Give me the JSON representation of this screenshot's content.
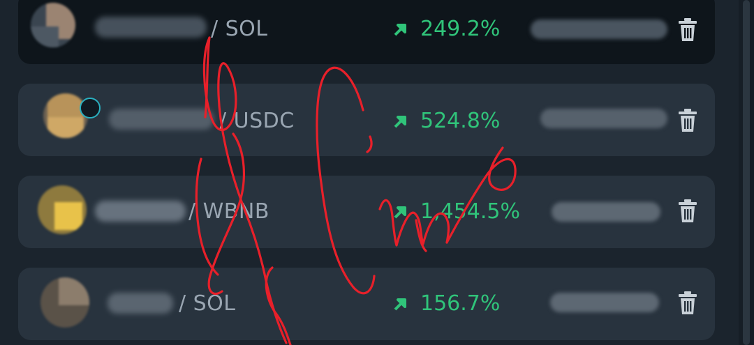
{
  "positions": [
    {
      "pair_label": "/ SOL",
      "change": "249.2%",
      "selected": true,
      "avatar_color": "#9b8472",
      "name_shade": "#4a5560"
    },
    {
      "pair_label": "/ USDC",
      "change": "524.8%",
      "selected": false,
      "avatar_color": "#b8935a",
      "name_shade": "#56616c"
    },
    {
      "pair_label": "/ WBNB",
      "change": "1,454.5%",
      "selected": false,
      "avatar_color": "#e8c24a",
      "name_shade": "#6b7682"
    },
    {
      "pair_label": "/ SOL",
      "change": "156.7%",
      "selected": false,
      "avatar_color": "#8c7d6c",
      "name_shade": "#5d6873"
    }
  ],
  "colors": {
    "background": "#1b242d",
    "card": "#28333e",
    "card_selected": "#0e151b",
    "positive": "#30c47a",
    "pair_text": "#9aa6b2",
    "trash": "#c9d1d8",
    "ink": "#e8202a"
  },
  "icons": {
    "trend": "arrow-up-right-icon",
    "delete": "trash-icon"
  }
}
